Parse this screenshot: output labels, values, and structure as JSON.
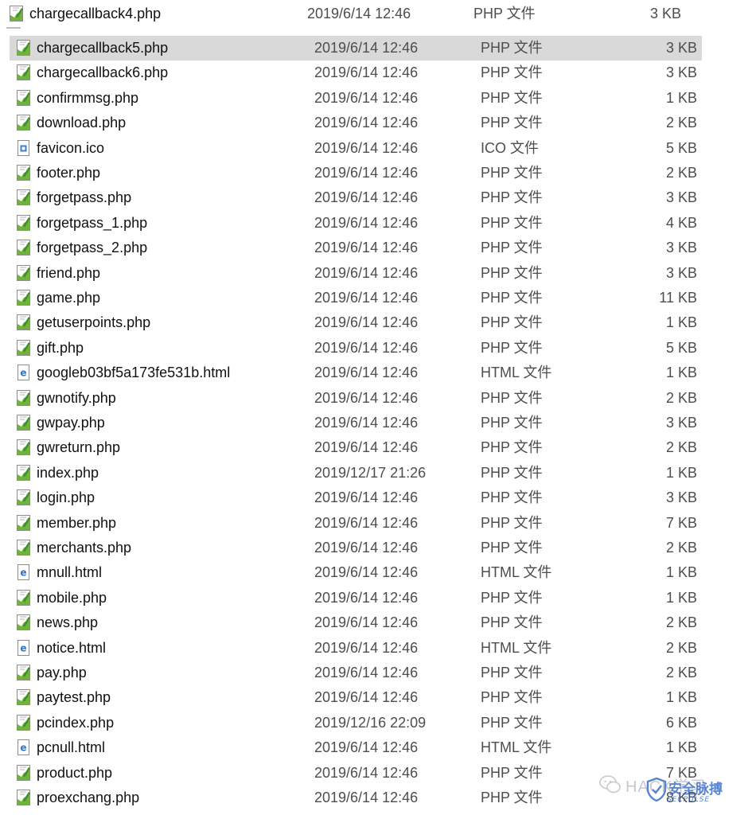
{
  "rows": [
    {
      "name": "chargecallback4.php",
      "date": "2019/6/14 12:46",
      "type": "PHP 文件",
      "size": "3 KB",
      "icon": "php-file-icon"
    },
    {
      "name": "chargecallback5.php",
      "date": "2019/6/14 12:46",
      "type": "PHP 文件",
      "size": "3 KB",
      "icon": "php-file-icon",
      "selected": true
    },
    {
      "name": "chargecallback6.php",
      "date": "2019/6/14 12:46",
      "type": "PHP 文件",
      "size": "3 KB",
      "icon": "php-file-icon"
    },
    {
      "name": "confirmmsg.php",
      "date": "2019/6/14 12:46",
      "type": "PHP 文件",
      "size": "1 KB",
      "icon": "php-file-icon"
    },
    {
      "name": "download.php",
      "date": "2019/6/14 12:46",
      "type": "PHP 文件",
      "size": "2 KB",
      "icon": "php-file-icon"
    },
    {
      "name": "favicon.ico",
      "date": "2019/6/14 12:46",
      "type": "ICO 文件",
      "size": "5 KB",
      "icon": "ico-file-icon"
    },
    {
      "name": "footer.php",
      "date": "2019/6/14 12:46",
      "type": "PHP 文件",
      "size": "2 KB",
      "icon": "php-file-icon"
    },
    {
      "name": "forgetpass.php",
      "date": "2019/6/14 12:46",
      "type": "PHP 文件",
      "size": "3 KB",
      "icon": "php-file-icon"
    },
    {
      "name": "forgetpass_1.php",
      "date": "2019/6/14 12:46",
      "type": "PHP 文件",
      "size": "4 KB",
      "icon": "php-file-icon"
    },
    {
      "name": "forgetpass_2.php",
      "date": "2019/6/14 12:46",
      "type": "PHP 文件",
      "size": "3 KB",
      "icon": "php-file-icon"
    },
    {
      "name": "friend.php",
      "date": "2019/6/14 12:46",
      "type": "PHP 文件",
      "size": "3 KB",
      "icon": "php-file-icon"
    },
    {
      "name": "game.php",
      "date": "2019/6/14 12:46",
      "type": "PHP 文件",
      "size": "11 KB",
      "icon": "php-file-icon"
    },
    {
      "name": "getuserpoints.php",
      "date": "2019/6/14 12:46",
      "type": "PHP 文件",
      "size": "1 KB",
      "icon": "php-file-icon"
    },
    {
      "name": "gift.php",
      "date": "2019/6/14 12:46",
      "type": "PHP 文件",
      "size": "5 KB",
      "icon": "php-file-icon"
    },
    {
      "name": "googleb03bf5a173fe531b.html",
      "date": "2019/6/14 12:46",
      "type": "HTML 文件",
      "size": "1 KB",
      "icon": "html-file-icon"
    },
    {
      "name": "gwnotify.php",
      "date": "2019/6/14 12:46",
      "type": "PHP 文件",
      "size": "2 KB",
      "icon": "php-file-icon"
    },
    {
      "name": "gwpay.php",
      "date": "2019/6/14 12:46",
      "type": "PHP 文件",
      "size": "3 KB",
      "icon": "php-file-icon"
    },
    {
      "name": "gwreturn.php",
      "date": "2019/6/14 12:46",
      "type": "PHP 文件",
      "size": "2 KB",
      "icon": "php-file-icon"
    },
    {
      "name": "index.php",
      "date": "2019/12/17 21:26",
      "type": "PHP 文件",
      "size": "1 KB",
      "icon": "php-file-icon"
    },
    {
      "name": "login.php",
      "date": "2019/6/14 12:46",
      "type": "PHP 文件",
      "size": "3 KB",
      "icon": "php-file-icon"
    },
    {
      "name": "member.php",
      "date": "2019/6/14 12:46",
      "type": "PHP 文件",
      "size": "7 KB",
      "icon": "php-file-icon"
    },
    {
      "name": "merchants.php",
      "date": "2019/6/14 12:46",
      "type": "PHP 文件",
      "size": "2 KB",
      "icon": "php-file-icon"
    },
    {
      "name": "mnull.html",
      "date": "2019/6/14 12:46",
      "type": "HTML 文件",
      "size": "1 KB",
      "icon": "html-file-icon"
    },
    {
      "name": "mobile.php",
      "date": "2019/6/14 12:46",
      "type": "PHP 文件",
      "size": "1 KB",
      "icon": "php-file-icon"
    },
    {
      "name": "news.php",
      "date": "2019/6/14 12:46",
      "type": "PHP 文件",
      "size": "2 KB",
      "icon": "php-file-icon"
    },
    {
      "name": "notice.html",
      "date": "2019/6/14 12:46",
      "type": "HTML 文件",
      "size": "2 KB",
      "icon": "html-file-icon"
    },
    {
      "name": "pay.php",
      "date": "2019/6/14 12:46",
      "type": "PHP 文件",
      "size": "2 KB",
      "icon": "php-file-icon"
    },
    {
      "name": "paytest.php",
      "date": "2019/6/14 12:46",
      "type": "PHP 文件",
      "size": "1 KB",
      "icon": "php-file-icon"
    },
    {
      "name": "pcindex.php",
      "date": "2019/12/16 22:09",
      "type": "PHP 文件",
      "size": "6 KB",
      "icon": "php-file-icon"
    },
    {
      "name": "pcnull.html",
      "date": "2019/6/14 12:46",
      "type": "HTML 文件",
      "size": "1 KB",
      "icon": "html-file-icon"
    },
    {
      "name": "product.php",
      "date": "2019/6/14 12:46",
      "type": "PHP 文件",
      "size": "7 KB",
      "icon": "php-file-icon"
    },
    {
      "name": "proexchang.php",
      "date": "2019/6/14 12:46",
      "type": "PHP 文件",
      "size": "8 KB",
      "icon": "php-file-icon"
    }
  ],
  "watermark": {
    "text": "HACK学习",
    "brand": "安全脉搏",
    "sub": "SECPULSE"
  },
  "colors": {
    "selected_row": "#d9d9d9",
    "secondary_text": "#4d4d4d"
  }
}
